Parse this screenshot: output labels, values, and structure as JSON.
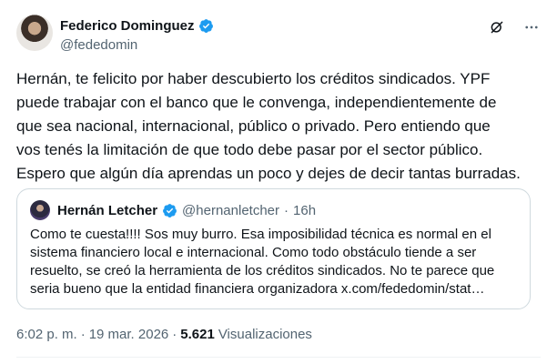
{
  "author": {
    "display_name": "Federico Dominguez",
    "handle": "@fededomin",
    "verified": true
  },
  "icons": {
    "grok": "grok-icon",
    "more": "more-dots-icon",
    "verified": "verified-badge-icon"
  },
  "tweet": {
    "text": "Hernán, te felicito por haber descubierto los créditos sindicados. YPF\npuede trabajar con el banco que le convenga, independientemente de\nque sea nacional, internacional, público o privado. Pero entiendo que\nvos tenés la limitación de que todo debe pasar por el sector público.\nEspero que algún día aprendas un poco y dejes de decir tantas burradas."
  },
  "quoted": {
    "display_name": "Hernán Letcher",
    "handle": "@hernanletcher",
    "separator": "·",
    "time": "16h",
    "text": "Como te cuesta!!!! Sos muy burro. Esa imposibilidad técnica es normal en el sistema financiero local e internacional. Como todo obstáculo tiende a ser resuelto, se creó la herramienta de los créditos sindicados. No te parece que seria bueno que la entidad financiera organizadora x.com/fededomin/stat…"
  },
  "meta": {
    "time": "6:02 p. m.",
    "separator1": "·",
    "date": "19 mar. 2026",
    "separator2": "·",
    "views_count": "5.621",
    "views_label": "Visualizaciones"
  },
  "colors": {
    "verified": "#1d9bf0",
    "text_primary": "#0f1419",
    "text_secondary": "#536471",
    "border": "#cfd9de"
  }
}
